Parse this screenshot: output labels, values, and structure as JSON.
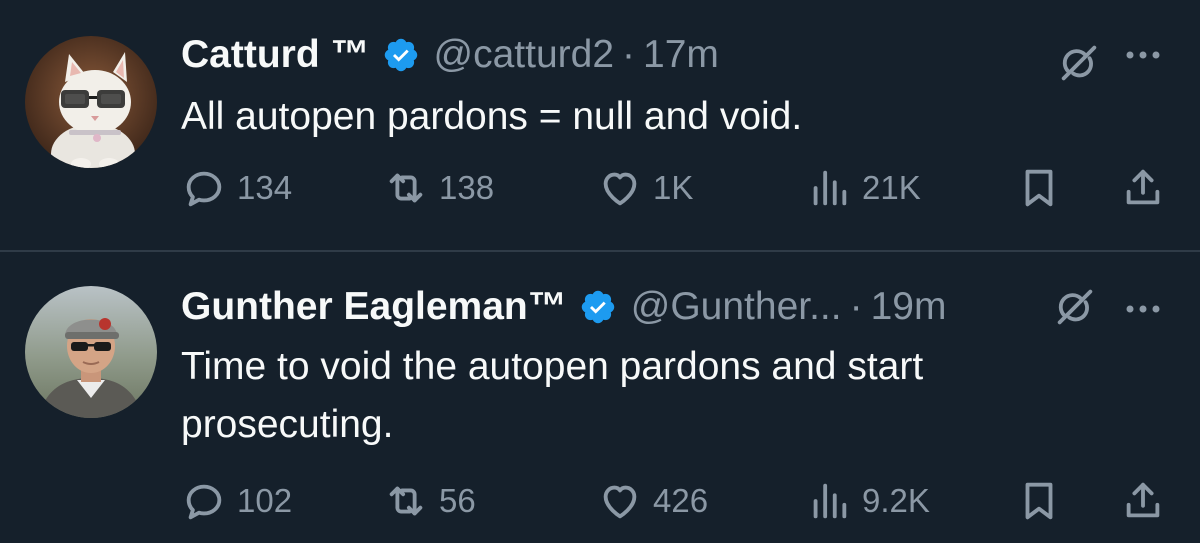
{
  "tweets": [
    {
      "display_name": "Catturd ™",
      "handle": "@catturd2",
      "separator": "·",
      "time": "17m",
      "text": "All autopen pardons = null and void.",
      "replies": "134",
      "reposts": "138",
      "likes": "1K",
      "views": "21K",
      "avatar": "cat-with-glasses-avatar"
    },
    {
      "display_name": "Gunther Eagleman™",
      "handle": "@Gunther...",
      "separator": "·",
      "time": "19m",
      "text": "Time to void the autopen pardons and start prosecuting.",
      "replies": "102",
      "reposts": "56",
      "likes": "426",
      "views": "9.2K",
      "avatar": "man-in-cap-sunglasses-avatar"
    }
  ],
  "icons": {
    "verified": "verified-badge-icon",
    "grok": "grok-icon",
    "more": "more-icon",
    "reply": "reply-icon",
    "repost": "repost-icon",
    "like": "like-icon",
    "views": "views-icon",
    "bookmark": "bookmark-icon",
    "share": "share-icon"
  },
  "colors": {
    "background": "#15202b",
    "text_primary": "#f7f9f9",
    "text_secondary": "#8b98a5",
    "verified_blue": "#1d9bf0",
    "divider": "#2f3b47"
  }
}
